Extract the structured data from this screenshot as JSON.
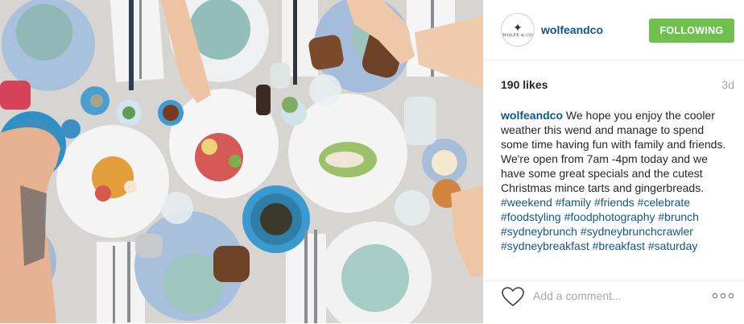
{
  "post": {
    "username": "wolfeandco",
    "avatar_text": "WOLFE & CO",
    "follow_label": "FOLLOWING",
    "likes": "190 likes",
    "time": "3d",
    "caption": {
      "author": "wolfeandco",
      "text": "We hope you enjoy the cooler weather this wend and manage to spend some time having fun with family and friends. We're open from 7am -4pm today and we have some great specials and the cutest Christmas mince tarts and gingerbreads.",
      "tags": [
        "#weekend",
        "#family",
        "#friends",
        "#celebrate",
        "#foodstyling",
        "#foodphotography",
        "#brunch",
        "#sydneybrunch",
        "#sydneybrunchcrawler",
        "#sydneybreakfast",
        "#breakfast",
        "#saturday"
      ]
    },
    "comment_placeholder": "Add a comment..."
  },
  "colors": {
    "link": "#125688",
    "following_green": "#70c050",
    "muted": "#a5a7aa"
  },
  "icons": {
    "like": "heart-outline-icon",
    "more": "more-options-icon"
  }
}
